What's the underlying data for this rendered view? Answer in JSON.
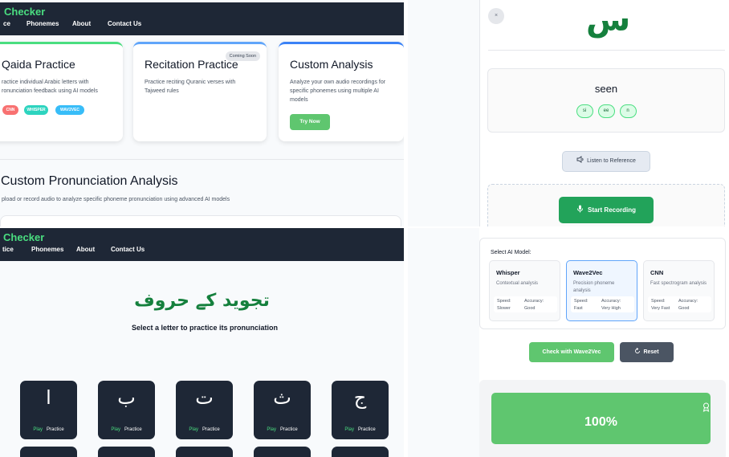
{
  "nav": {
    "brand": "Checker",
    "links_top": [
      "ce",
      "Phonemes",
      "About",
      "Contact Us"
    ],
    "links_bottom": [
      "tice",
      "Phonemes",
      "About",
      "Contact Us"
    ]
  },
  "features": {
    "cards": [
      {
        "title": "Qaida Practice",
        "desc": "ractice individual Arabic letters with ronunciation feedback using AI models",
        "tags": [
          "CNN",
          "WHISPER",
          "WAV2VEC"
        ]
      },
      {
        "title": "Recitation Practice",
        "badge": "Coming Soon",
        "desc": "Practice reciting Quranic verses with Tajweed rules"
      },
      {
        "title": "Custom Analysis",
        "desc": "Analyze your own audio recordings for specific phonemes using multiple AI models",
        "button": "Try Now"
      }
    ],
    "section_title": "Custom Pronunciation Analysis",
    "section_subtitle": "pload or record audio to analyze specific phoneme pronunciation using advanced AI models"
  },
  "letter_practice": {
    "close_label": "×",
    "letter": "س",
    "name": "seen",
    "phonemes": [
      "si",
      "ee",
      "n"
    ],
    "listen_label": "Listen to Reference",
    "record_label": "Start Recording"
  },
  "letter_grid": {
    "title": "تجوید کے حروف",
    "subtitle": "Select a letter to practice its pronunciation",
    "letters": [
      "ا",
      "ب",
      "ت",
      "ث",
      "ج"
    ],
    "play_label": "Play",
    "practice_label": "Practice"
  },
  "model_select": {
    "label": "Select AI Model:",
    "models": [
      {
        "name": "Whisper",
        "desc": "Contextual analysis",
        "speed_label": "Speed:",
        "speed": "Slower",
        "accuracy_label": "Accuracy:",
        "accuracy": "Good"
      },
      {
        "name": "Wave2Vec",
        "desc": "Precision phoneme analysis",
        "speed_label": "Speed:",
        "speed": "Fast",
        "accuracy_label": "Accuracy:",
        "accuracy": "Very High",
        "selected": true
      },
      {
        "name": "CNN",
        "desc": "Fast spectrogram analysis",
        "speed_label": "Speed:",
        "speed": "Very Fast",
        "accuracy_label": "Accuracy:",
        "accuracy": "Good"
      }
    ],
    "check_label": "Check with Wave2Vec",
    "reset_label": "Reset",
    "score": "100%"
  },
  "colors": {
    "nav_bg": "#1e2736",
    "brand_green": "#4ade80",
    "success": "#5fc66f",
    "record": "#22a35a",
    "arabic_green": "#15803d",
    "tag_cnn": "#f87171",
    "tag_whisper": "#2dd4bf",
    "tag_wav2vec": "#38bdf8",
    "selected_border": "#60a5fa"
  },
  "icons": {
    "listen": "speaker-icon",
    "record": "microphone-icon",
    "reset": "reset-icon",
    "score": "medal-icon"
  }
}
